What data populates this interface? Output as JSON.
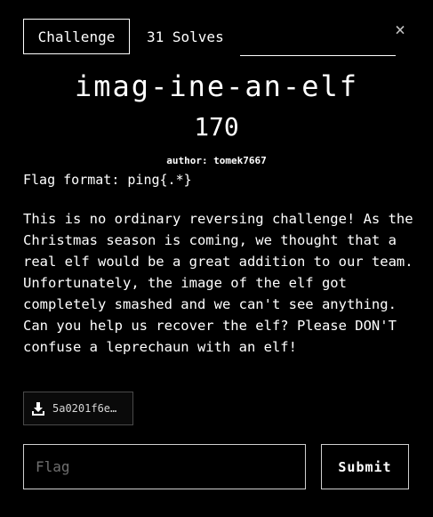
{
  "tabs": {
    "challenge_label": "Challenge",
    "solves_label": "31 Solves"
  },
  "close_glyph": "×",
  "challenge": {
    "title": "imag-ine-an-elf",
    "points": "170",
    "author": "author: tomek7667",
    "flag_format": "Flag format: ping{.*}",
    "description": "This is no ordinary reversing challenge! As the Christmas season is coming, we thought that a real elf would be a great addition to our team. Unfortunately, the image of the elf got completely smashed and we can't see anything. Can you help us recover the elf? Please DON'T confuse a leprechaun with an elf!"
  },
  "attachment": {
    "icon": "download-icon",
    "filename": "5a0201f6e…"
  },
  "form": {
    "flag_placeholder": "Flag",
    "flag_value": "",
    "submit_label": "Submit"
  }
}
